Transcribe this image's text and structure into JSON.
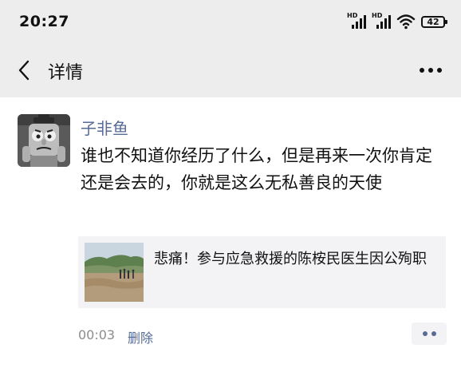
{
  "status_bar": {
    "time": "20:27",
    "network_labels": [
      "HD",
      "HD"
    ],
    "battery_level": "42",
    "icons": [
      "signal-icon",
      "signal-icon",
      "wifi-icon",
      "battery-icon"
    ]
  },
  "header": {
    "title": "详情",
    "back_icon": "chevron-left-icon",
    "more_icon": "more-dots-icon"
  },
  "post": {
    "author": "子非鱼",
    "text": "谁也不知道你经历了什么，但是再来一次你肯定还是会去的，你就是这么无私善良的天使",
    "link_card": {
      "title": "悲痛！参与应急救援的陈桉民医生因公殉职",
      "thumbnail_icon": "flood-scene-thumbnail"
    },
    "time": "00:03",
    "delete_label": "删除",
    "action_icon": "comment-dots-icon"
  },
  "colors": {
    "header_bg": "#ededed",
    "link_blue": "#576b95",
    "card_bg": "#f3f3f5",
    "meta_gray": "#8c8c8c"
  }
}
